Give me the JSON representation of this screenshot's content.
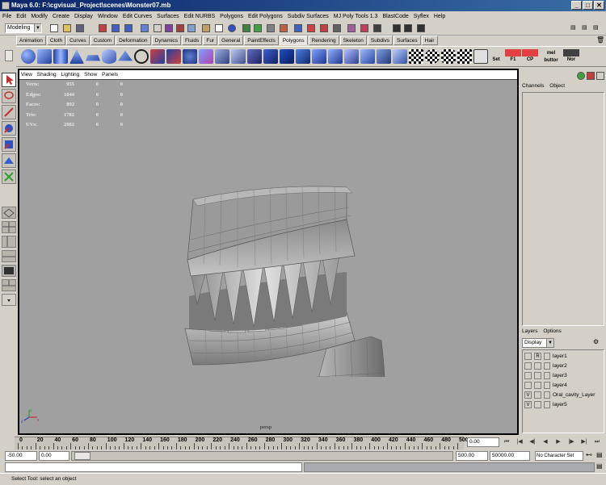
{
  "window": {
    "title": "Maya 6.0: F:\\cgvisual_Project\\scenes\\Monster07.mb",
    "min": "_",
    "max": "□",
    "close": "✕"
  },
  "menu": [
    "File",
    "Edit",
    "Modify",
    "Create",
    "Display",
    "Window",
    "Edit Curves",
    "Surfaces",
    "Edit NURBS",
    "Polygons",
    "Edit Polygons",
    "Subdiv Surfaces",
    "MJ Poly Tools 1.3",
    "BlastCode",
    "Syflex",
    "Help"
  ],
  "status": {
    "mode": "Modeling"
  },
  "shelf_tabs": [
    "Animation",
    "Cloth",
    "Curves",
    "Custom",
    "Deformation",
    "Dynamics",
    "Fluids",
    "Fur",
    "General",
    "PaintEffects",
    "Polygons",
    "Rendering",
    "Skeleton",
    "Subdivs",
    "Surfaces",
    "Hair"
  ],
  "active_shelf": "Polygons",
  "shelf_text_icons": [
    "Set",
    "F1",
    "CP",
    "mel buttor",
    "Nor"
  ],
  "viewport_menu": [
    "View",
    "Shading",
    "Lighting",
    "Show",
    "Panels"
  ],
  "hud": [
    {
      "label": "Verts:",
      "a": "955",
      "b": "0",
      "c": "0"
    },
    {
      "label": "Edges:",
      "a": "1844",
      "b": "0",
      "c": "0"
    },
    {
      "label": "Faces:",
      "a": "892",
      "b": "0",
      "c": "0"
    },
    {
      "label": "Tris:",
      "a": "1782",
      "b": "0",
      "c": "0"
    },
    {
      "label": "UVs:",
      "a": "2082",
      "b": "0",
      "c": "0"
    }
  ],
  "camera": "persp",
  "axes": {
    "x": "x",
    "y": "y",
    "z": "z"
  },
  "channel_box": {
    "tabs": [
      "Channels",
      "Object"
    ]
  },
  "layers_panel": {
    "menu": [
      "Layers",
      "Options"
    ],
    "display": "Display",
    "layers": [
      {
        "v": "",
        "r": "R",
        "name": "layer1"
      },
      {
        "v": "",
        "r": "",
        "name": "layer2"
      },
      {
        "v": "",
        "r": "",
        "name": "layer3"
      },
      {
        "v": "",
        "r": "",
        "name": "layer4"
      },
      {
        "v": "V",
        "r": "",
        "name": "Oral_cavity_Layer"
      },
      {
        "v": "V",
        "r": "",
        "name": "layer5"
      }
    ]
  },
  "time_slider": {
    "labels": [
      "0",
      "20",
      "40",
      "60",
      "80",
      "100",
      "120",
      "140",
      "160",
      "180",
      "200",
      "220",
      "240",
      "260",
      "280",
      "300",
      "320",
      "340",
      "360",
      "380",
      "400",
      "420",
      "440",
      "460",
      "480",
      "500"
    ],
    "current_frame": "0.00"
  },
  "range": {
    "start": "-50.00",
    "inner_start": "0.00",
    "inner_end": "500.00",
    "end": "50000.00",
    "character_set": "No Character Set"
  },
  "help_line": "Select Tool: select an object",
  "colors": {
    "title_start": "#0a246a",
    "title_end": "#3a6ea5",
    "viewport_bg": "#a0a0a0",
    "ui_bg": "#d4d0c8"
  }
}
